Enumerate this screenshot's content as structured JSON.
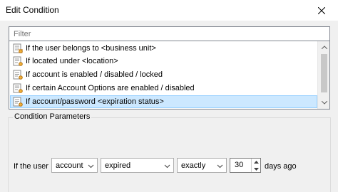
{
  "window": {
    "title": "Edit Condition",
    "close_glyph": "✕"
  },
  "filter": {
    "placeholder": "Filter",
    "value": ""
  },
  "conditions": [
    {
      "label": "If the user belongs to <business unit>",
      "icon": "condition-icon",
      "selected": false
    },
    {
      "label": "If located under <location>",
      "icon": "condition-icon",
      "selected": false
    },
    {
      "label": "If account is enabled / disabled / locked",
      "icon": "condition-icon",
      "selected": false
    },
    {
      "label": "If certain Account Options are enabled / disabled",
      "icon": "condition-icon",
      "selected": false
    },
    {
      "label": "If account/password <expiration status>",
      "icon": "condition-icon",
      "selected": true
    }
  ],
  "parameters": {
    "legend": "Condition Parameters",
    "prefix": "If the user",
    "object_select": "account",
    "status_select": "expired",
    "comparison_select": "exactly",
    "days_value": "30",
    "suffix": "days ago"
  },
  "colors": {
    "selection": "#cce8ff",
    "selection_border": "#99d1ff",
    "panel": "#f0f0f0"
  }
}
